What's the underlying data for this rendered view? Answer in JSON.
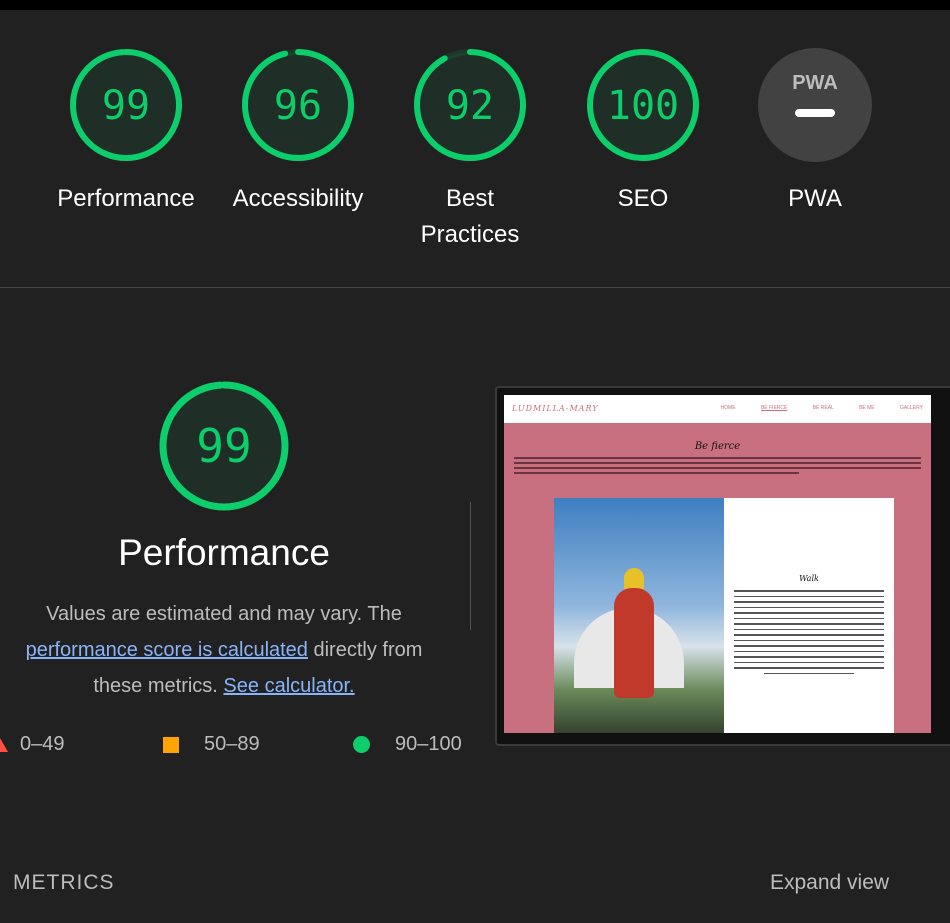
{
  "colors": {
    "pass": "#0cce6b",
    "average": "#ffa400",
    "fail": "#ff4e42",
    "link": "#8ab4f8"
  },
  "summary": [
    {
      "label": "Performance",
      "score": "99",
      "fraction": 0.99
    },
    {
      "label": "Accessibility",
      "score": "96",
      "fraction": 0.96
    },
    {
      "label": "Best Practices",
      "score": "92",
      "fraction": 0.92
    },
    {
      "label": "SEO",
      "score": "100",
      "fraction": 1.0
    }
  ],
  "pwa": {
    "badge": "PWA",
    "label": "PWA"
  },
  "performance": {
    "score": "99",
    "fraction": 0.99,
    "title": "Performance",
    "desc_before": "Values are estimated and may vary. The ",
    "desc_link": "performance score is calculated",
    "desc_middle": " directly from these metrics. ",
    "calc_link": "See calculator."
  },
  "legend": {
    "fail": "0–49",
    "average": "50–89",
    "pass": "90–100"
  },
  "screenshot": {
    "site_name": "LUDMILLA-MARY",
    "nav": [
      "HOME",
      "BE FIERCE",
      "BE REAL",
      "BE ME",
      "GALLERY"
    ],
    "heading": "Be fierce",
    "card_heading": "Walk"
  },
  "metrics_label": "METRICS",
  "expand_label": "Expand view"
}
